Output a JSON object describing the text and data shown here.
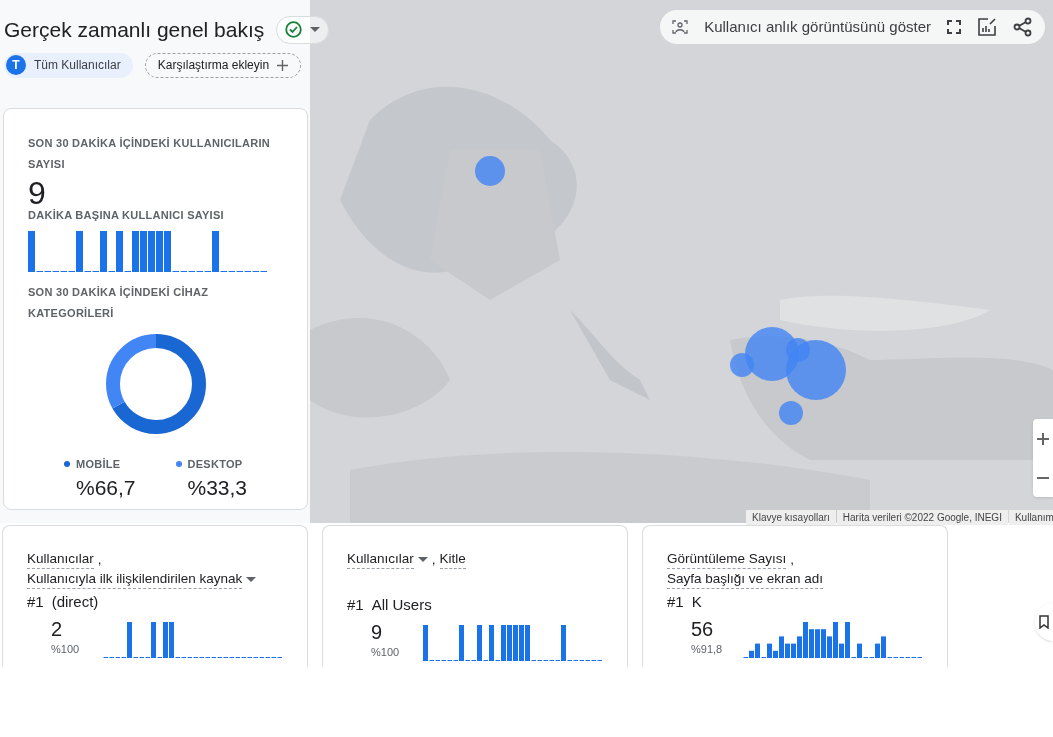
{
  "header": {
    "title": "Gerçek zamanlı genel bakış",
    "status_ok": true
  },
  "filters": {
    "segment": {
      "initial": "T",
      "label": "Tüm Kullanıcılar"
    },
    "add_comparison": "Karşılaştırma ekleyin"
  },
  "toolbar": {
    "snapshot": "Kullanıcı anlık görüntüsünü göster"
  },
  "map": {
    "kind": "picture",
    "attribution": [
      "Klavye kısayolları",
      "Harita verileri ©2022 Google, INEGI",
      "Kullanım"
    ]
  },
  "summary_card": {
    "users_title": "SON 30 DAKİKA İÇİNDEKİ KULLANICILARIN SAYISI",
    "users_value": "9",
    "per_minute_title": "DAKİKA BAŞINA KULLANICI SAYISI",
    "devices_title": "SON 30 DAKİKA İÇİNDEKİ CİHAZ KATEGORİLERİ",
    "chart_data": {
      "type": "donut",
      "categories": [
        "MOBİLE",
        "DESKTOP"
      ],
      "values": [
        66.7,
        33.3
      ],
      "colors": [
        "#1967d2",
        "#4285f4"
      ],
      "value_labels": [
        "%66,7",
        "%33,3"
      ],
      "legend": true
    }
  },
  "cards": [
    {
      "metric": "Kullanıcılar",
      "separator": ",",
      "dimension": "Kullanıcıyla ilk ilişkilendirilen kaynak",
      "metric_dropdown": false,
      "dimension_dropdown": true,
      "rank": "#1",
      "top_item": "(direct)",
      "value": "2",
      "share": "%100"
    },
    {
      "metric": "Kullanıcılar",
      "separator": ",",
      "dimension": "Kitle",
      "metric_dropdown": true,
      "dimension_dropdown": false,
      "rank": "#1",
      "top_item": "All Users",
      "value": "9",
      "share": "%100"
    },
    {
      "metric": "Görüntüleme Sayısı",
      "separator": ",",
      "dimension": "Sayfa başlığı ve ekran adı",
      "metric_dropdown": false,
      "dimension_dropdown": false,
      "rank": "#1",
      "top_item": "K",
      "value": "56",
      "share": "%91,8"
    }
  ]
}
